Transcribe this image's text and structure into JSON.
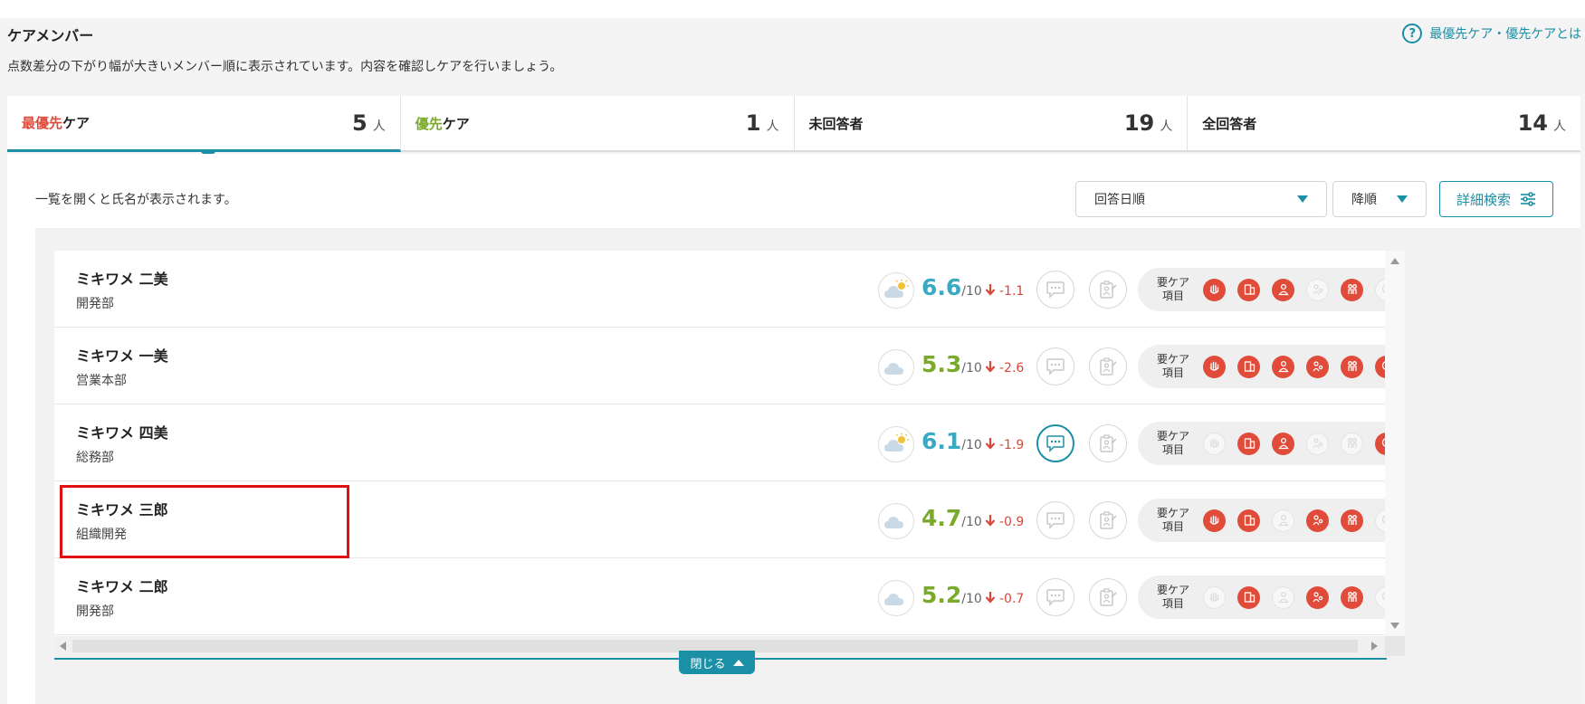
{
  "header": {
    "title": "ケアメンバー",
    "description": "点数差分の下がり幅が大きいメンバー順に表示されています。内容を確認しケアを行いましょう。",
    "help_link": "最優先ケア・優先ケアとは",
    "help_icon_glyph": "?"
  },
  "tabs": [
    {
      "prefix": "最優先",
      "suffix": "ケア",
      "count": "5",
      "unit": "人"
    },
    {
      "prefix": "優先",
      "suffix": "ケア",
      "count": "1",
      "unit": "人"
    },
    {
      "prefix": "",
      "suffix": "未回答者",
      "count": "19",
      "unit": "人"
    },
    {
      "prefix": "",
      "suffix": "全回答者",
      "count": "14",
      "unit": "人"
    }
  ],
  "panel": {
    "hint": "一覧を開くと氏名が表示されます。",
    "sort_value": "回答日順",
    "order_value": "降順",
    "advanced_search": "詳細検索",
    "close_label": "閉じる"
  },
  "care_label": "要ケア\n項目",
  "colors": {
    "accent": "#1a8fa5",
    "alert": "#e04b3a",
    "score_blue": "#39a9c4",
    "score_green": "#7aaa2a"
  },
  "members": [
    {
      "name": "ミキワメ 二美",
      "dept": "開発部",
      "weather": "sun-cloud-icon",
      "score": "6.6",
      "denom": "/10",
      "delta": "-1.1",
      "score_color": "blue",
      "comment_active": false,
      "care": [
        true,
        true,
        true,
        false,
        true,
        false
      ]
    },
    {
      "name": "ミキワメ 一美",
      "dept": "営業本部",
      "weather": "cloud-icon",
      "score": "5.3",
      "denom": "/10",
      "delta": "-2.6",
      "score_color": "green",
      "comment_active": false,
      "care": [
        true,
        true,
        true,
        true,
        true,
        true
      ]
    },
    {
      "name": "ミキワメ 四美",
      "dept": "総務部",
      "weather": "sun-cloud-icon",
      "score": "6.1",
      "denom": "/10",
      "delta": "-1.9",
      "score_color": "blue",
      "comment_active": true,
      "care": [
        false,
        true,
        true,
        false,
        false,
        true
      ]
    },
    {
      "name": "ミキワメ 三郎",
      "dept": "組織開発",
      "weather": "cloud-icon",
      "score": "4.7",
      "denom": "/10",
      "delta": "-0.9",
      "score_color": "green",
      "comment_active": false,
      "care": [
        true,
        true,
        false,
        true,
        true,
        false
      ]
    },
    {
      "name": "ミキワメ 二郎",
      "dept": "開発部",
      "weather": "cloud-icon",
      "score": "5.2",
      "denom": "/10",
      "delta": "-0.7",
      "score_color": "green",
      "comment_active": false,
      "care": [
        false,
        true,
        false,
        true,
        true,
        false
      ]
    }
  ],
  "care_icons": [
    "hand-icon",
    "building-icon",
    "person-icon",
    "family-icon",
    "people-icon",
    "brain-icon"
  ]
}
